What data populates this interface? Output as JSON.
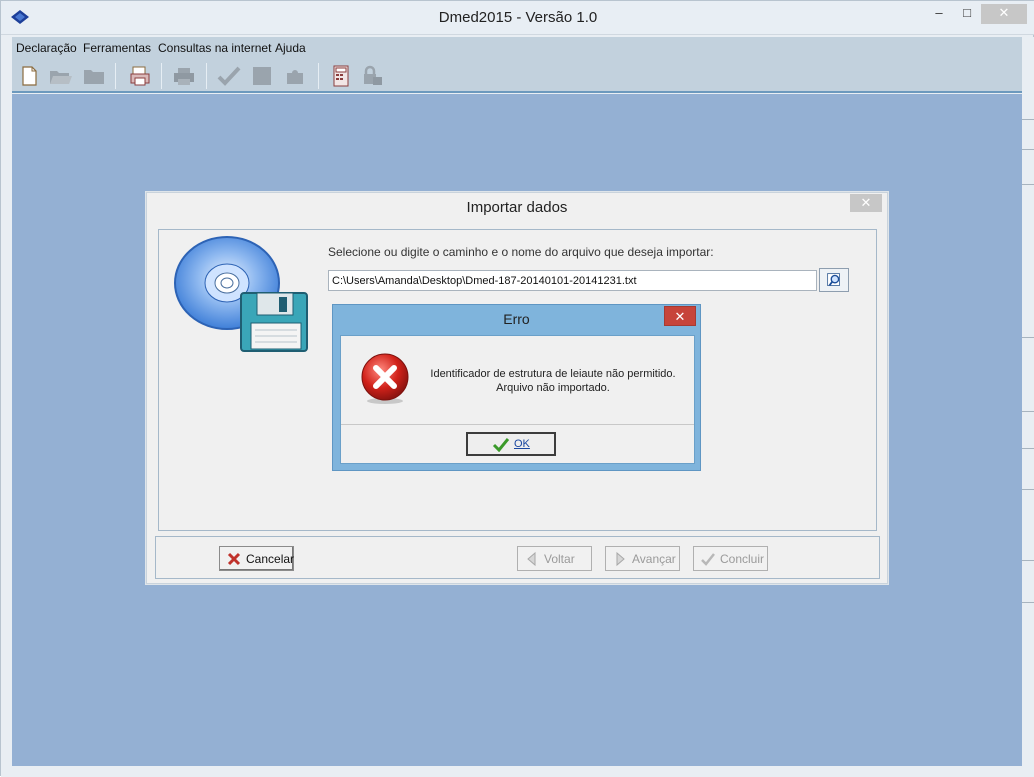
{
  "window": {
    "title": "Dmed2015 - Versão 1.0",
    "minimize": "–",
    "maximize": "□",
    "close": "✕"
  },
  "menu": {
    "items": [
      "Declaração",
      "Ferramentas",
      "Consultas na internet",
      "Ajuda"
    ]
  },
  "toolbar": {
    "icons": [
      "new-file-icon",
      "open-folder-icon",
      "folder-icon",
      "print-icon",
      "printer-icon",
      "check-icon",
      "stop-icon",
      "puzzle-icon",
      "calculator-icon",
      "lock-icon"
    ]
  },
  "import_dialog": {
    "title": "Importar dados",
    "close": "✕",
    "prompt": "Selecione ou digite o caminho e o nome do arquivo que deseja importar:",
    "path_value": "C:\\Users\\Amanda\\Desktop\\Dmed-187-20140101-20141231.txt",
    "buttons": {
      "cancel": "Cancelar",
      "back": "Voltar",
      "forward": "Avançar",
      "finish": "Concluir"
    }
  },
  "error_dialog": {
    "title": "Erro",
    "close": "✕",
    "message_line1": "Identificador de estrutura de leiaute não permitido.",
    "message_line2": "Arquivo não importado.",
    "ok": "OK"
  },
  "colors": {
    "workspace": "#94b0d3",
    "toolbar": "#c2d1dd",
    "error_frame": "#7fb4dc",
    "error_close": "#c7443a"
  }
}
